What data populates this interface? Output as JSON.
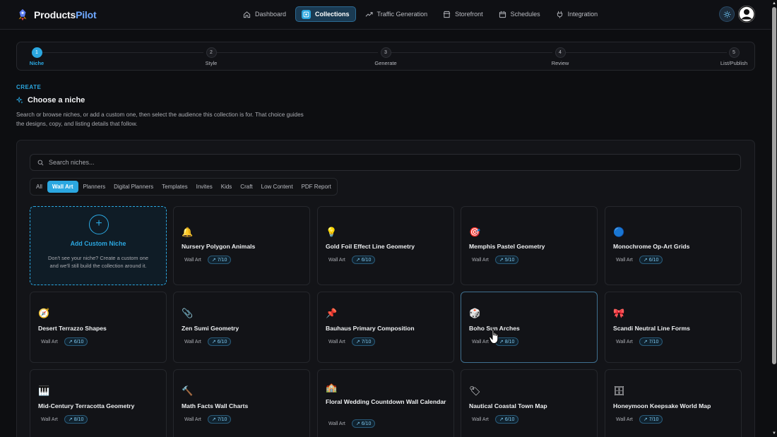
{
  "brand": {
    "name_main": "Products",
    "name_accent": "Pilot"
  },
  "nav": [
    {
      "label": "Dashboard",
      "icon": "home-icon"
    },
    {
      "label": "Collections",
      "icon": "collections-icon",
      "active": true
    },
    {
      "label": "Traffic Generation",
      "icon": "trending-icon"
    },
    {
      "label": "Storefront",
      "icon": "store-icon"
    },
    {
      "label": "Schedules",
      "icon": "calendar-icon"
    },
    {
      "label": "Integration",
      "icon": "plug-icon"
    }
  ],
  "stepper": [
    {
      "num": "1",
      "label": "Niche",
      "active": true
    },
    {
      "num": "2",
      "label": "Style"
    },
    {
      "num": "3",
      "label": "Generate"
    },
    {
      "num": "4",
      "label": "Review"
    },
    {
      "num": "5",
      "label": "List/Publish"
    }
  ],
  "header": {
    "eyebrow": "CREATE",
    "title": "Choose a niche",
    "description": "Search or browse niches, or add a custom one, then select the audience this collection is for. That choice guides the designs, copy, and listing details that follow."
  },
  "search": {
    "placeholder": "Search niches..."
  },
  "tabs": [
    "All",
    "Wall Art",
    "Planners",
    "Digital Planners",
    "Templates",
    "Invites",
    "Kids",
    "Craft",
    "Low Content",
    "PDF Report"
  ],
  "active_tab": "Wall Art",
  "add_card": {
    "title": "Add Custom Niche",
    "description": "Don't see your niche? Create a custom one and we'll still build the collection around it."
  },
  "niches": [
    {
      "title": "Nursery Polygon Animals",
      "icon": "🔔",
      "category": "Wall Art",
      "score": "7/10"
    },
    {
      "title": "Gold Foil Effect Line Geometry",
      "icon": "💡",
      "category": "Wall Art",
      "score": "6/10"
    },
    {
      "title": "Memphis Pastel Geometry",
      "icon": "🎯",
      "category": "Wall Art",
      "score": "5/10"
    },
    {
      "title": "Monochrome Op-Art Grids",
      "icon": "🔵",
      "category": "Wall Art",
      "score": "6/10"
    },
    {
      "title": "Desert Terrazzo Shapes",
      "icon": "🧭",
      "category": "Wall Art",
      "score": "6/10"
    },
    {
      "title": "Zen Sumi Geometry",
      "icon": "📎",
      "category": "Wall Art",
      "score": "6/10"
    },
    {
      "title": "Bauhaus Primary Composition",
      "icon": "📌",
      "category": "Wall Art",
      "score": "7/10"
    },
    {
      "title": "Boho Sun Arches",
      "icon": "🎲",
      "category": "Wall Art",
      "score": "8/10",
      "selected": true
    },
    {
      "title": "Scandi Neutral Line Forms",
      "icon": "🎀",
      "category": "Wall Art",
      "score": "7/10"
    },
    {
      "title": "Mid-Century Terracotta Geometry",
      "icon": "🎹",
      "category": "Wall Art",
      "score": "8/10"
    },
    {
      "title": "Math Facts Wall Charts",
      "icon": "🔨",
      "category": "Wall Art",
      "score": "7/10"
    },
    {
      "title": "Floral Wedding Countdown Wall Calendar",
      "icon": "🏫",
      "category": "Wall Art",
      "score": "6/10"
    },
    {
      "title": "Nautical Coastal Town Map",
      "icon": "🏷",
      "category": "Wall Art",
      "score": "6/10"
    },
    {
      "title": "Honeymoon Keepsake World Map",
      "icon": "🗄",
      "category": "Wall Art",
      "score": "7/10"
    }
  ],
  "colors": {
    "accent": "#2ba7e0",
    "background": "#0d0e11",
    "card": "#121317"
  }
}
